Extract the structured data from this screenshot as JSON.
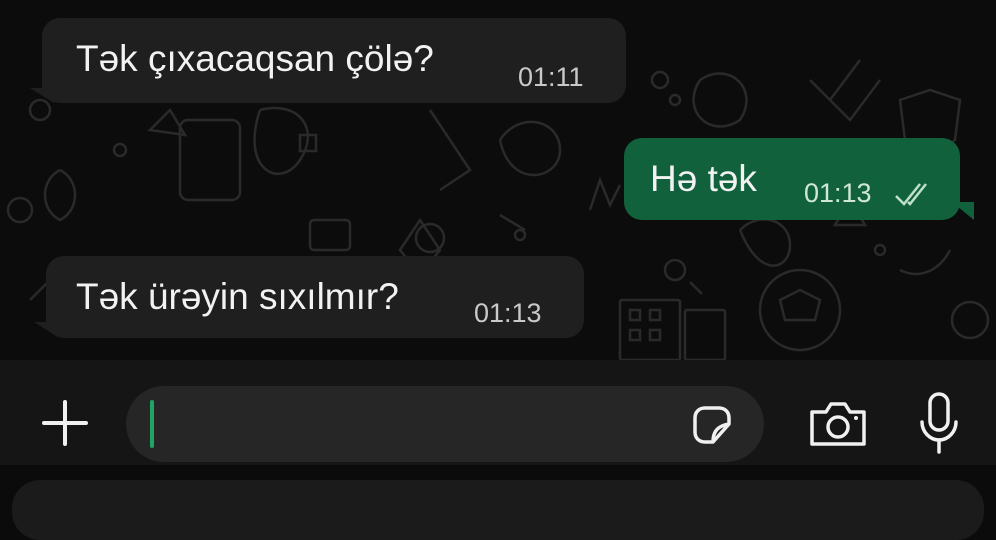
{
  "messages": [
    {
      "direction": "incoming",
      "text": "Tək çıxacaqsan çölə?",
      "time": "01:11"
    },
    {
      "direction": "outgoing",
      "text": "Hə tək",
      "time": "01:13",
      "status": "double-check-icon"
    },
    {
      "direction": "incoming",
      "text": "Tək ürəyin sıxılmır?",
      "time": "01:13"
    }
  ],
  "composer": {
    "message_value": "",
    "attach_icon": "plus-icon",
    "sticker_icon": "sticker-icon",
    "camera_icon": "camera-icon",
    "mic_icon": "microphone-icon"
  },
  "colors": {
    "background": "#0c0c0c",
    "incoming_bubble": "#1f1f1f",
    "outgoing_bubble": "#11623c",
    "caret": "#1fa463"
  }
}
